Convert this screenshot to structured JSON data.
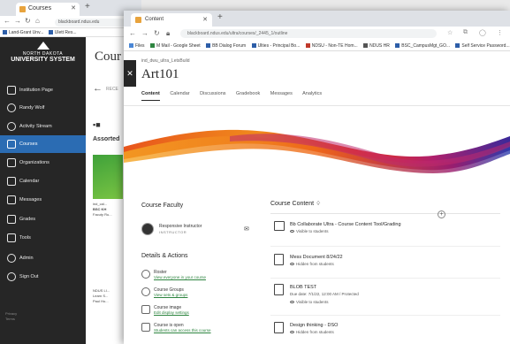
{
  "back_browser": {
    "tab_title": "Courses",
    "url": "blackboard.ndus.edu",
    "bookmarks": [
      "Land-Grant Unv...",
      "Ulett Res..."
    ]
  },
  "back_sidebar": {
    "logo_line1": "NORTH DAKOTA",
    "logo_line2": "UNIVERSITY SYSTEM",
    "items": [
      {
        "label": "Institution Page",
        "icon": "institution-icon"
      },
      {
        "label": "Randy Wolf",
        "icon": "user-icon"
      },
      {
        "label": "Activity Stream",
        "icon": "activity-icon"
      },
      {
        "label": "Courses",
        "icon": "courses-icon",
        "active": true
      },
      {
        "label": "Organizations",
        "icon": "organizations-icon"
      },
      {
        "label": "Calendar",
        "icon": "calendar-icon"
      },
      {
        "label": "Messages",
        "icon": "messages-icon"
      },
      {
        "label": "Grades",
        "icon": "grades-icon"
      },
      {
        "label": "Tools",
        "icon": "tools-icon"
      },
      {
        "label": "Admin",
        "icon": "admin-icon"
      },
      {
        "label": "Sign Out",
        "icon": "sign-out-icon"
      }
    ],
    "footer": [
      "Privacy",
      "Terms"
    ]
  },
  "back_main": {
    "title": "Cour",
    "back_label": "RECE",
    "section": "Assorted",
    "card1": [
      "ind_cal...",
      "BSC KH",
      "Facuty Ru..."
    ],
    "card2": [
      "NDUS LI...",
      "Learn S...",
      "Paul Ho..."
    ]
  },
  "front_browser": {
    "tab_title": "Content",
    "url": "blackboard.ndus.edu/ultra/courses/_2445_1/outline",
    "bookmarks": [
      {
        "label": "Files",
        "color": "#4a87d6"
      },
      {
        "label": "M Mail - Google Sheet",
        "color": "#2e8540"
      },
      {
        "label": "BB Dialog Forum",
        "color": "#2d5ea8"
      },
      {
        "label": "Ulties - Principal Bo...",
        "color": "#2d5ea8"
      },
      {
        "label": "NDSU - Non-TE Hom...",
        "color": "#c0392b"
      },
      {
        "label": "NDUS HR",
        "color": "#555555"
      },
      {
        "label": "BSC_CampusMgt_GO...",
        "color": "#2d5ea8"
      },
      {
        "label": "Self Service Password...",
        "color": "#2d5ea8"
      }
    ]
  },
  "course": {
    "id": "ind_dwu_ultra_LetsBuild",
    "title": "Art101",
    "tabs": [
      {
        "label": "Content",
        "active": true
      },
      {
        "label": "Calendar"
      },
      {
        "label": "Discussions"
      },
      {
        "label": "Gradebook"
      },
      {
        "label": "Messages"
      },
      {
        "label": "Analytics"
      }
    ]
  },
  "faculty": {
    "heading": "Course Faculty",
    "name": "Responsive Instructor",
    "role": "INSTRUCTOR"
  },
  "details": {
    "heading": "Details & Actions",
    "items": [
      {
        "title": "Roster",
        "link": "View everyone in your course",
        "icon": "roster-icon"
      },
      {
        "title": "Course Groups",
        "link": "View sets & groups",
        "icon": "groups-icon"
      },
      {
        "title": "Course image",
        "link": "Edit display settings",
        "icon": "course-image-icon"
      },
      {
        "title": "Course is open",
        "link": "Students can access this course",
        "icon": "lock-open-icon"
      }
    ]
  },
  "content": {
    "heading": "Course Content",
    "items": [
      {
        "title": "Bb Collaborate Ultra - Course Content Tool/Grading",
        "sub": "",
        "vis": "Visible to students",
        "icon": "collaborate-icon"
      },
      {
        "title": "Mess Document 8/24/22",
        "sub": "",
        "vis": "Hidden from students",
        "icon": "document-icon"
      },
      {
        "title": "BLOB TEST",
        "sub": "Due date: 7/1/22, 12:00 AM  /  Protected",
        "vis": "Visible to students",
        "icon": "assignment-icon"
      },
      {
        "title": "Design thinking - DSO",
        "sub": "",
        "vis": "Hidden from students",
        "icon": "document-icon"
      }
    ]
  }
}
